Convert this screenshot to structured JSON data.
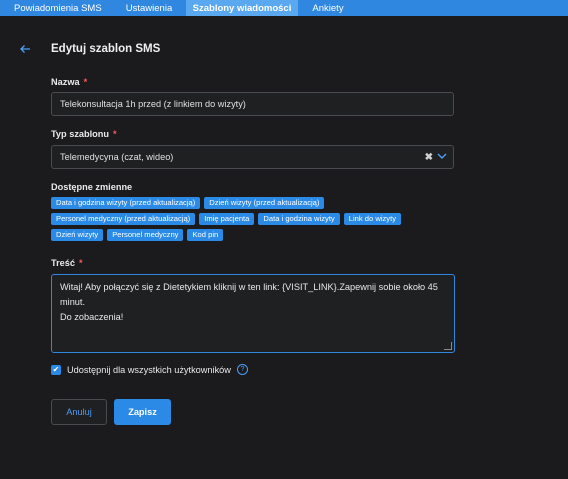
{
  "tabs": [
    {
      "label": "Powiadomienia SMS"
    },
    {
      "label": "Ustawienia"
    },
    {
      "label": "Szablony wiadomości"
    },
    {
      "label": "Ankiety"
    }
  ],
  "page": {
    "title": "Edytuj szablon SMS"
  },
  "name_field": {
    "label": "Nazwa",
    "required": "*",
    "value": "Telekonsultacja 1h przed (z linkiem do wizyty)"
  },
  "type_field": {
    "label": "Typ szablonu",
    "required": "*",
    "value": "Telemedycyna (czat, wideo)",
    "clear": "✖"
  },
  "variables": {
    "label": "Dostępne zmienne",
    "rows": [
      [
        "Data i godzina wizyty (przed aktualizacją)",
        "Dzień wizyty (przed aktualizacją)"
      ],
      [
        "Personel medyczny (przed aktualizacją)",
        "Imię pacjenta",
        "Data i godzina wizyty",
        "Link do wizyty"
      ],
      [
        "Dzień wizyty",
        "Personel medyczny",
        "Kod pin"
      ]
    ]
  },
  "content": {
    "label": "Treść",
    "required": "*",
    "line1": "Witaj! Aby połączyć się z Dietetykiem kliknij w ten link: {VISIT_LINK}.",
    "line1b": "Zapewnij sobie około 45 minut.",
    "line2": "Do zobaczenia!"
  },
  "share": {
    "label": "Udostępnij dla wszystkich użytkowników",
    "checked": true,
    "help": "?"
  },
  "buttons": {
    "cancel": "Anuluj",
    "save": "Zapisz"
  },
  "colors": {
    "accent": "#2b8ae6",
    "background": "#1b1b1d",
    "required": "#ff5a5a"
  }
}
